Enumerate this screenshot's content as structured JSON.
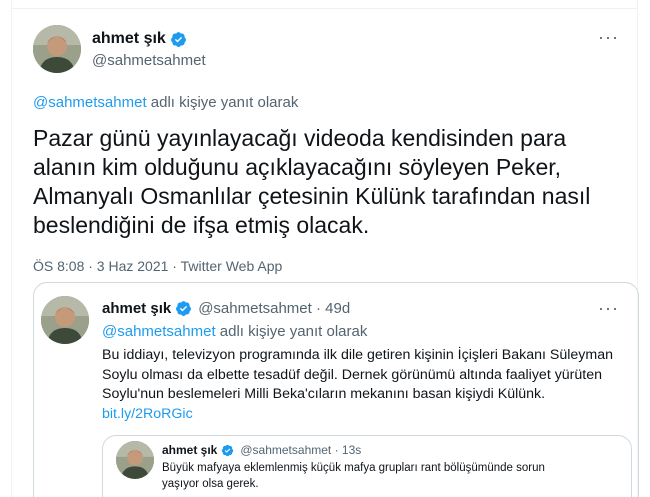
{
  "main_tweet": {
    "name": "ahmet şık",
    "handle": "@sahmetsahmet",
    "reply_to": {
      "mention": "@sahmetsahmet",
      "suffix": " adlı kişiye yanıt olarak"
    },
    "text": "Pazar günü yayınlayacağı videoda kendisinden para alanın kim olduğunu açıklayacağını söyleyen Peker, Almanyalı Osmanlılar çetesinin Külünk tarafından nasıl beslendiğini de ifşa etmiş olacak.",
    "meta": "ÖS 8:08 · 3 Haz 2021 · Twitter Web App",
    "more_icon": "more-dots-icon"
  },
  "quoted_tweet": {
    "name": "ahmet şık",
    "handle": "@sahmetsahmet · 49d",
    "reply_to": {
      "mention": "@sahmetsahmet",
      "suffix": " adlı kişiye yanıt olarak"
    },
    "text": "Bu iddiayı, televizyon programında ilk dile getiren kişinin İçişleri Bakanı Süleyman Soylu olması da elbette tesadüf değil. Dernek görünümü altında faaliyet yürüten Soylu'nun beslemeleri Milli Beka'cıların mekanını basan kişiydi Külünk. ",
    "link": "bit.ly/2RoRGic"
  },
  "inner_quote": {
    "name": "ahmet şık",
    "handle": "@sahmetsahmet · 13s",
    "text": "Büyük mafyaya eklemlenmiş küçük mafya grupları rant bölüşümünde sorun yaşıyor olsa gerek."
  },
  "colors": {
    "accent": "#1d9bf0",
    "secondary_text": "#536471",
    "border": "#cfd9de"
  }
}
